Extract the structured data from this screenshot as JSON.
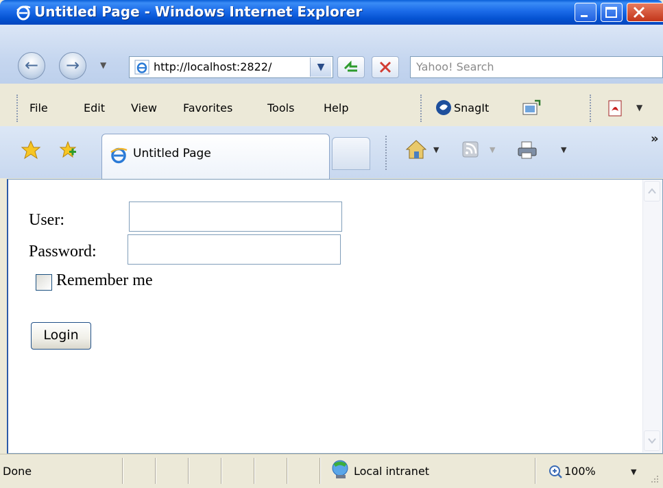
{
  "window": {
    "title": "Untitled Page - Windows Internet Explorer"
  },
  "address": {
    "url": "http://localhost:2822/",
    "search_placeholder": "Yahoo! Search"
  },
  "menu": {
    "items": [
      "File",
      "Edit",
      "View",
      "Favorites",
      "Tools",
      "Help"
    ],
    "snagit": "SnagIt"
  },
  "tabs": {
    "active_label": "Untitled Page",
    "more": "»"
  },
  "form": {
    "user_label": "User:",
    "user_value": "",
    "password_label": "Password:",
    "password_value": "",
    "remember_label": "Remember me",
    "remember_checked": false,
    "login_label": "Login"
  },
  "status": {
    "text": "Done",
    "zone": "Local intranet",
    "zoom": "100%"
  }
}
